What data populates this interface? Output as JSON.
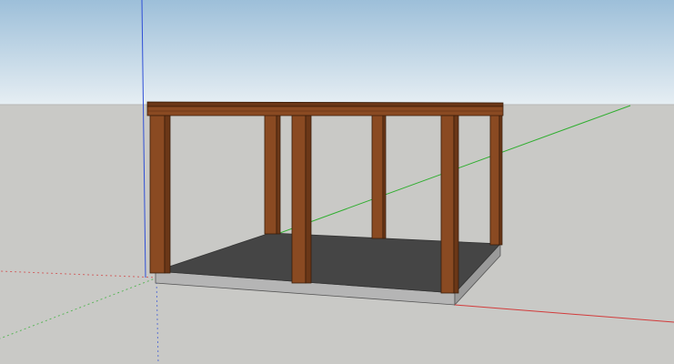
{
  "app": {
    "view": "3d-modeling-viewport"
  },
  "scene": {
    "sky_top_color": "#9dbfd9",
    "sky_bottom_color": "#e6eef3",
    "ground_color": "#c9c9c6",
    "axes": {
      "red_axis_color": "#d23b3b",
      "green_axis_color": "#2fae2f",
      "blue_axis_color": "#2f4fd6"
    },
    "model": {
      "name": "timber-frame-pavilion",
      "wood_front_color": "#8a4a22",
      "wood_side_color": "#6b3717",
      "floor_color": "#454545",
      "slab_front_color": "#b5b5b5",
      "slab_side_color": "#9a9a9a"
    }
  }
}
